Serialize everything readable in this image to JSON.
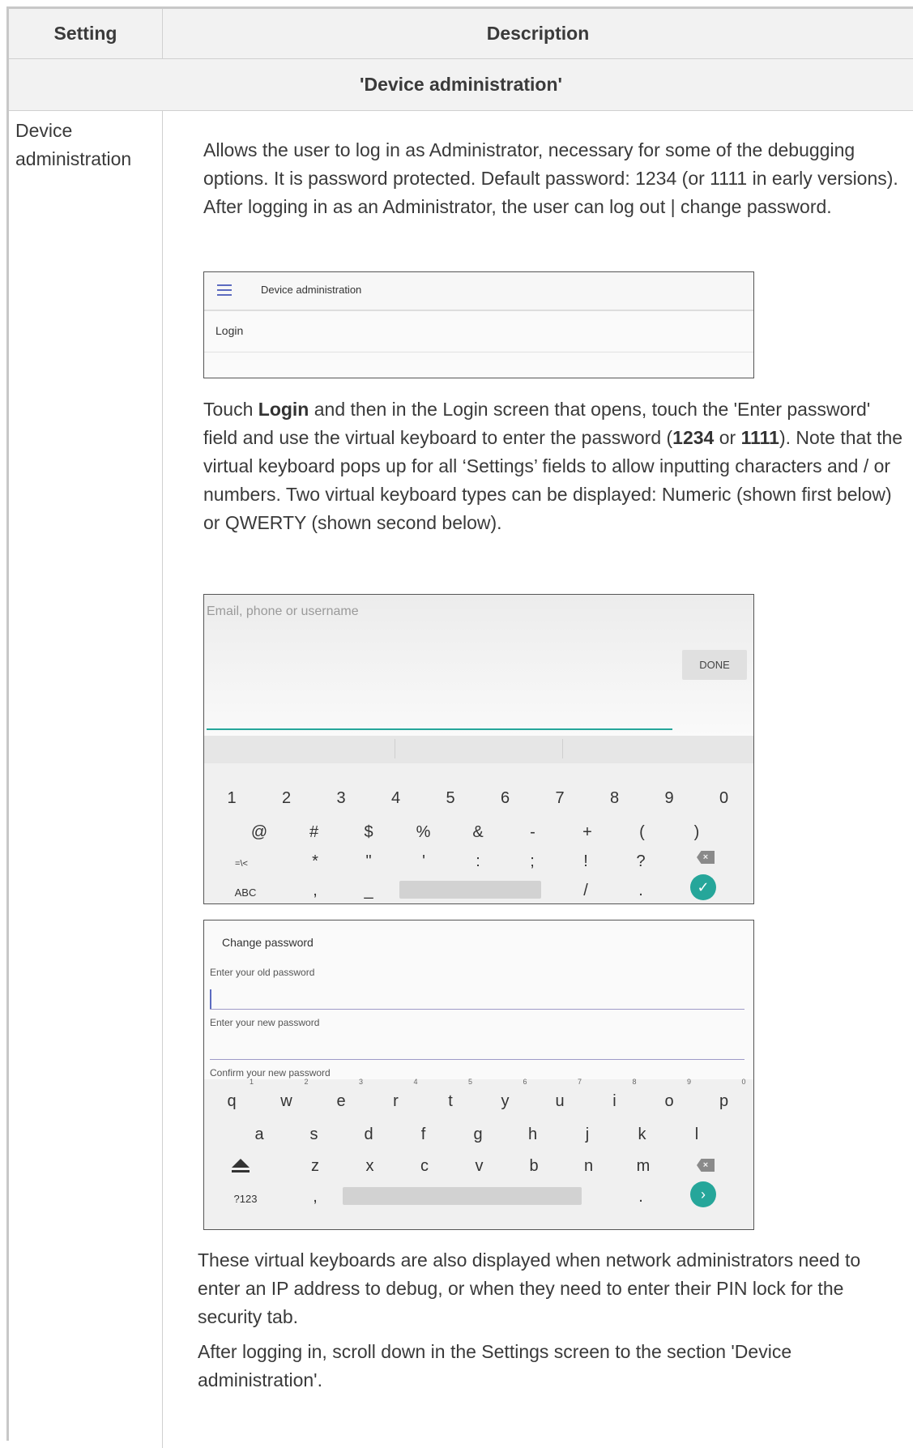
{
  "table": {
    "header": {
      "setting": "Setting",
      "description": "Description"
    },
    "section_title": "'Device administration'",
    "row": {
      "setting": "Device administration"
    }
  },
  "content": {
    "para1": "Allows the user to log in as Administrator, necessary for some of the debugging options. It is password protected. Default password: 1234 (or 1111 in early versions). After logging in as an Administrator, the user can log out | change password.",
    "para2_a": "Touch ",
    "para2_login": "Login",
    "para2_b": " and then in the Login screen that opens, touch the 'Enter password' field and use the virtual keyboard to enter the password (",
    "para2_1234": "1234",
    "para2_or": " or ",
    "para2_1111": "1111",
    "para2_c": "). Note that the virtual keyboard pops up for all ‘Settings’ fields to allow inputting characters and / or numbers. Two virtual keyboard types can be displayed: Numeric (shown first below) or QWERTY (shown second below).",
    "para3": "These virtual keyboards are also displayed when network administrators need to enter an IP address to debug, or when they need to enter their PIN lock for the security tab.",
    "para4": "After logging in, scroll down in the Settings screen to the section 'Device administration'."
  },
  "shot1": {
    "title": "Device administration",
    "item": "Login",
    "icon": "menu-icon"
  },
  "shot2": {
    "placeholder": "Email, phone or username",
    "done": "DONE",
    "row1": [
      "1",
      "2",
      "3",
      "4",
      "5",
      "6",
      "7",
      "8",
      "9",
      "0"
    ],
    "row2": [
      "@",
      "#",
      "$",
      "%",
      "&",
      "-",
      "+",
      "(",
      ")"
    ],
    "row3": [
      "=\\<",
      "*",
      "\"",
      "'",
      ":",
      ";",
      "!",
      "?"
    ],
    "row4_left": "ABC",
    "row4_comma": ",",
    "row4_under": "_",
    "row4_slash": "/",
    "row4_dot": ".",
    "enter": "✓"
  },
  "shot3": {
    "title": "Change password",
    "old_label": "Enter your old password",
    "new_label": "Enter your new password",
    "confirm_label": "Confirm your new password",
    "row1": [
      "q",
      "w",
      "e",
      "r",
      "t",
      "y",
      "u",
      "i",
      "o",
      "p"
    ],
    "row1_sup": [
      "1",
      "2",
      "3",
      "4",
      "5",
      "6",
      "7",
      "8",
      "9",
      "0"
    ],
    "row2": [
      "a",
      "s",
      "d",
      "f",
      "g",
      "h",
      "j",
      "k",
      "l"
    ],
    "row3": [
      "z",
      "x",
      "c",
      "v",
      "b",
      "n",
      "m"
    ],
    "row4_left": "?123",
    "row4_comma": ",",
    "row4_dot": ".",
    "enter": "›"
  }
}
